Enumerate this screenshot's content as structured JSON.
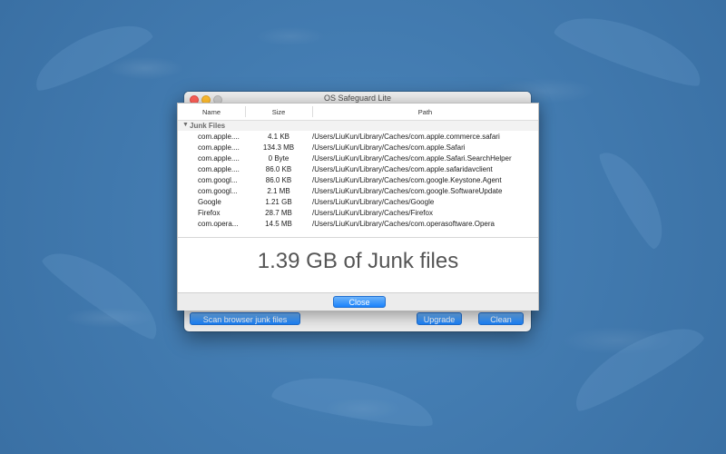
{
  "window": {
    "title": "OS Safeguard Lite"
  },
  "buttons": {
    "scan": "Scan browser junk files",
    "upgrade": "Upgrade",
    "clean": "Clean",
    "close": "Close"
  },
  "table": {
    "columns": [
      "Name",
      "Size",
      "Path"
    ],
    "group": "Junk Files",
    "rows": [
      {
        "name": "com.apple....",
        "size": "4.1 KB",
        "path": "/Users/LiuKun/Library/Caches/com.apple.commerce.safari"
      },
      {
        "name": "com.apple....",
        "size": "134.3 MB",
        "path": "/Users/LiuKun/Library/Caches/com.apple.Safari"
      },
      {
        "name": "com.apple....",
        "size": "0 Byte",
        "path": "/Users/LiuKun/Library/Caches/com.apple.Safari.SearchHelper"
      },
      {
        "name": "com.apple....",
        "size": "86.0 KB",
        "path": "/Users/LiuKun/Library/Caches/com.apple.safaridavclient"
      },
      {
        "name": "com.googl...",
        "size": "86.0 KB",
        "path": "/Users/LiuKun/Library/Caches/com.google.Keystone.Agent"
      },
      {
        "name": "com.googl...",
        "size": "2.1 MB",
        "path": "/Users/LiuKun/Library/Caches/com.google.SoftwareUpdate"
      },
      {
        "name": "Google",
        "size": "1.21 GB",
        "path": "/Users/LiuKun/Library/Caches/Google"
      },
      {
        "name": "Firefox",
        "size": "28.7 MB",
        "path": "/Users/LiuKun/Library/Caches/Firefox"
      },
      {
        "name": "com.opera...",
        "size": "14.5 MB",
        "path": "/Users/LiuKun/Library/Caches/com.operasoftware.Opera"
      }
    ]
  },
  "summary": "1.39 GB of Junk files",
  "colors": {
    "accent": "#1a82fb",
    "desktop": "#3f78ad"
  }
}
